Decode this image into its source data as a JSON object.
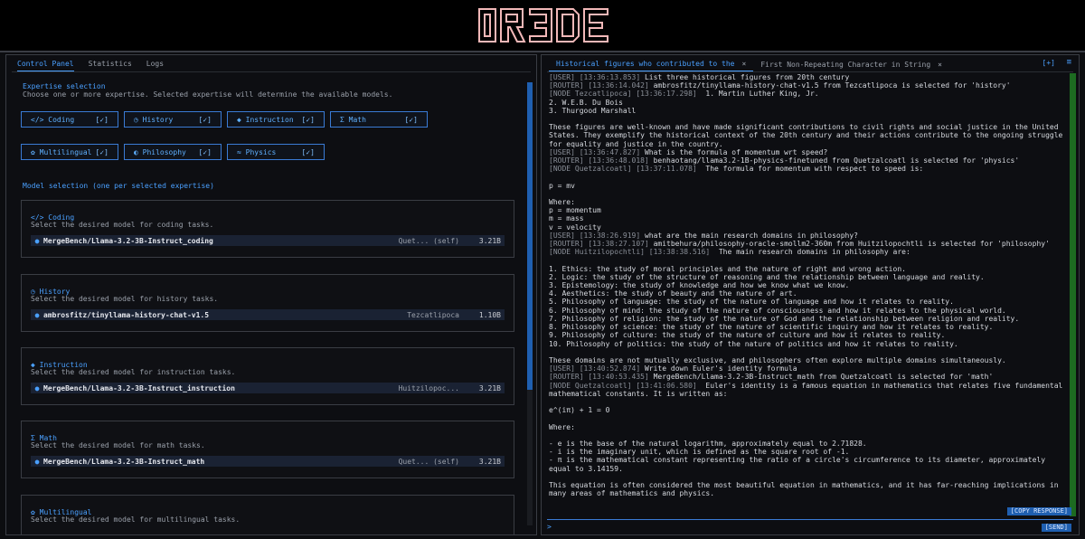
{
  "app": {
    "logo": "IR3DE"
  },
  "left_tabs": [
    "Control Panel",
    "Statistics",
    "Logs"
  ],
  "expertise": {
    "title": "Expertise selection",
    "subtitle": "Choose one or more expertise. Selected expertise will determine the available models.",
    "items": [
      {
        "icon": "</>",
        "label": "Coding",
        "check": "[✓]"
      },
      {
        "icon": "◷",
        "label": "History",
        "check": "[✓]"
      },
      {
        "icon": "◆",
        "label": "Instruction",
        "check": "[✓]"
      },
      {
        "icon": "Σ",
        "label": "Math",
        "check": "[✓]"
      },
      {
        "icon": "✿",
        "label": "Multilingual",
        "check": "[✓]"
      },
      {
        "icon": "◐",
        "label": "Philosophy",
        "check": "[✓]"
      },
      {
        "icon": "≈",
        "label": "Physics",
        "check": "[✓]"
      }
    ]
  },
  "models": {
    "title": "Model selection (one per selected expertise)",
    "cards": [
      {
        "icon": "</>",
        "title": "Coding",
        "subtitle": "Select the desired model for coding tasks.",
        "model": "MergeBench/Llama-3.2-3B-Instruct_coding",
        "provider": "Quet... (self)",
        "size": "3.21B"
      },
      {
        "icon": "◷",
        "title": "History",
        "subtitle": "Select the desired model for history tasks.",
        "model": "ambrosfitz/tinyllama-history-chat-v1.5",
        "provider": "Tezcatlipoca",
        "size": "1.10B"
      },
      {
        "icon": "◆",
        "title": "Instruction",
        "subtitle": "Select the desired model for instruction tasks.",
        "model": "MergeBench/Llama-3.2-3B-Instruct_instruction",
        "provider": "Huitzilopoc...",
        "size": "3.21B"
      },
      {
        "icon": "Σ",
        "title": "Math",
        "subtitle": "Select the desired model for math tasks.",
        "model": "MergeBench/Llama-3.2-3B-Instruct_math",
        "provider": "Quet... (self)",
        "size": "3.21B"
      },
      {
        "icon": "✿",
        "title": "Multilingual",
        "subtitle": "Select the desired model for multilingual tasks.",
        "model": "",
        "provider": "",
        "size": ""
      }
    ]
  },
  "right_tabs": [
    {
      "label": "Historical figures who contributed to the",
      "close": "×"
    },
    {
      "label": "First Non-Repeating Character in String",
      "close": "×"
    }
  ],
  "right_controls": {
    "add": "[+]",
    "menu": "≡"
  },
  "chat": [
    {
      "tag": "[USER] [13:36:13.853]",
      "text": " List three historical figures from 20th century"
    },
    {
      "tag": "[ROUTER] [13:36:14.042]",
      "text": " ambrosfitz/tinyllama-history-chat-v1.5 from Tezcatlipoca is selected for 'history'"
    },
    {
      "tag": "[NODE Tezcatlipoca] [13:36:17.298]",
      "text": "  1. Martin Luther King, Jr.\n2. W.E.B. Du Bois\n3. Thurgood Marshall\n\nThese figures are well-known and have made significant contributions to civil rights and social justice in the United States. They exemplify the historical context of the 20th century and their actions contribute to the ongoing struggle for equality and justice in the country."
    },
    {
      "tag": "[USER] [13:36:47.827]",
      "text": " What is the formula of momentum wrt speed?"
    },
    {
      "tag": "[ROUTER] [13:36:48.018]",
      "text": " benhaotang/llama3.2-1B-physics-finetuned from Quetzalcoatl is selected for 'physics'"
    },
    {
      "tag": "[NODE Quetzalcoatl] [13:37:11.078]",
      "text": "  The formula for momentum with respect to speed is:\n\np = mv\n\nWhere:\np = momentum\nm = mass\nv = velocity"
    },
    {
      "tag": "[USER] [13:38:26.919]",
      "text": " what are the main research domains in philosophy?"
    },
    {
      "tag": "[ROUTER] [13:38:27.107]",
      "text": " amitbehura/philosophy-oracle-smollm2-360m from Huitzilopochtli is selected for 'philosophy'"
    },
    {
      "tag": "[NODE Huitzilopochtli] [13:38:38.516]",
      "text": "  The main research domains in philosophy are:\n\n1. Ethics: the study of moral principles and the nature of right and wrong action.\n2. Logic: the study of the structure of reasoning and the relationship between language and reality.\n3. Epistemology: the study of knowledge and how we know what we know.\n4. Aesthetics: the study of beauty and the nature of art.\n5. Philosophy of language: the study of the nature of language and how it relates to reality.\n6. Philosophy of mind: the study of the nature of consciousness and how it relates to the physical world.\n7. Philosophy of religion: the study of the nature of God and the relationship between religion and reality.\n8. Philosophy of science: the study of the nature of scientific inquiry and how it relates to reality.\n9. Philosophy of culture: the study of the nature of culture and how it relates to reality.\n10. Philosophy of politics: the study of the nature of politics and how it relates to reality.\n\nThese domains are not mutually exclusive, and philosophers often explore multiple domains simultaneously."
    },
    {
      "tag": "[USER] [13:40:52.874]",
      "text": " Write down Euler's identity formula"
    },
    {
      "tag": "[ROUTER] [13:40:53.435]",
      "text": " MergeBench/Llama-3.2-3B-Instruct_math from Quetzalcoatl is selected for 'math'"
    },
    {
      "tag": "[NODE Quetzalcoatl] [13:41:06.580]",
      "text": "  Euler's identity is a famous equation in mathematics that relates five fundamental mathematical constants. It is written as:\n\ne^(iπ) + 1 = 0\n\nWhere:\n\n- e is the base of the natural logarithm, approximately equal to 2.71828.\n- i is the imaginary unit, which is defined as the square root of -1.\n- π is the mathematical constant representing the ratio of a circle's circumference to its diameter, approximately equal to 3.14159.\n\nThis equation is often considered the most beautiful equation in mathematics, and it has far-reaching implications in many areas of mathematics and physics."
    }
  ],
  "copy_label": "[COPY RESPONSE]",
  "input": {
    "prompt": ">",
    "value": "",
    "placeholder": ""
  },
  "send_label": "[SEND]",
  "colors": {
    "accent": "#4aa0ff",
    "scroll_green": "#1d6b21",
    "logo": "#f2b8b8"
  }
}
